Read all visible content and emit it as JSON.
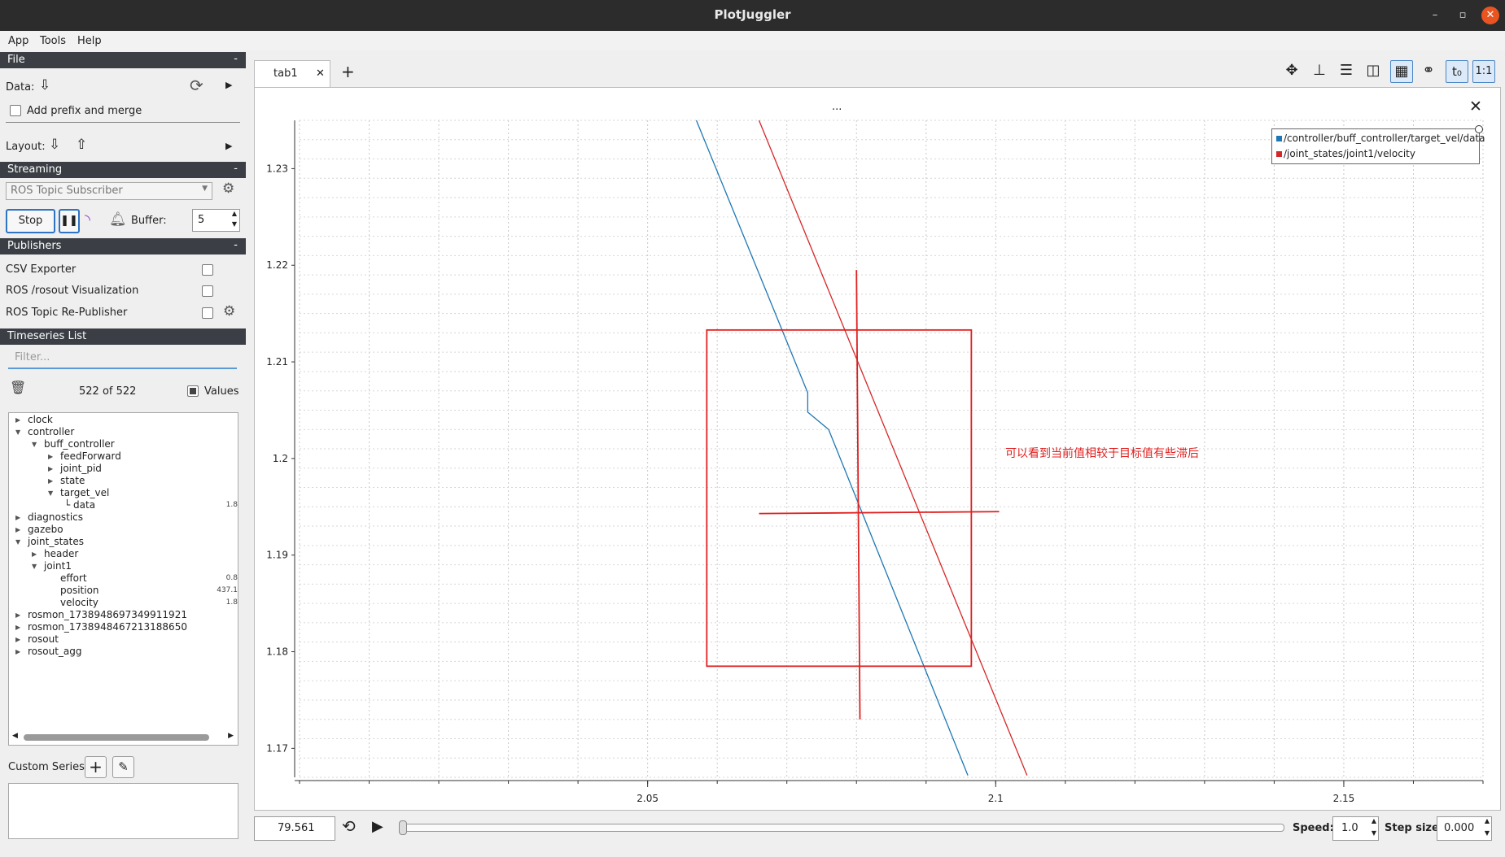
{
  "window": {
    "title": "PlotJuggler"
  },
  "menu": [
    "App",
    "Tools",
    "Help"
  ],
  "file": {
    "header": "File",
    "data_label": "Data:",
    "prefix_label": "Add prefix and merge",
    "layout_label": "Layout:"
  },
  "streaming": {
    "header": "Streaming",
    "source": "ROS Topic Subscriber",
    "stop_label": "Stop",
    "buffer_label": "Buffer:",
    "buffer_value": "5"
  },
  "publishers": {
    "header": "Publishers",
    "items": [
      "CSV Exporter",
      "ROS /rosout Visualization",
      "ROS Topic Re-Publisher"
    ]
  },
  "timeseries": {
    "header": "Timeseries List",
    "filter_placeholder": "Filter...",
    "count": "522 of 522",
    "values_label": "Values",
    "tree": [
      {
        "label": "clock",
        "arrow": "▶"
      },
      {
        "label": "controller",
        "arrow": "▼"
      },
      {
        "label": "buff_controller",
        "arrow": "▼"
      },
      {
        "label": "feedForward",
        "arrow": "▶"
      },
      {
        "label": "joint_pid",
        "arrow": "▶"
      },
      {
        "label": "state",
        "arrow": "▶"
      },
      {
        "label": "target_vel",
        "arrow": "▼"
      },
      {
        "label": "└ data",
        "value": "1.8"
      },
      {
        "label": "diagnostics",
        "arrow": "▶"
      },
      {
        "label": "gazebo",
        "arrow": "▶"
      },
      {
        "label": "joint_states",
        "arrow": "▼"
      },
      {
        "label": "header",
        "arrow": "▶"
      },
      {
        "label": "joint1",
        "arrow": "▼"
      },
      {
        "label": "effort",
        "value": "0.8"
      },
      {
        "label": "position",
        "value": "437.1"
      },
      {
        "label": "velocity",
        "value": "1.8"
      },
      {
        "label": "rosmon_1738948697349911921",
        "arrow": "▶"
      },
      {
        "label": "rosmon_1738948467213188650",
        "arrow": "▶"
      },
      {
        "label": "rosout",
        "arrow": "▶"
      },
      {
        "label": "rosout_agg",
        "arrow": "▶"
      }
    ]
  },
  "custom_series_label": "Custom Series:",
  "tabs": {
    "active": "tab1",
    "add": "+"
  },
  "plot": {
    "header_dots": "...",
    "annotation": "可以看到当前值相较于目标值有些滞后",
    "legend": [
      "/controller/buff_controller/target_vel/data",
      "/joint_states/joint1/velocity"
    ],
    "colors": {
      "series1": "#1f77b4",
      "series2": "#d62728",
      "annot": "#e02020"
    }
  },
  "chart_data": {
    "type": "line",
    "xlim": [
      2.0,
      2.17
    ],
    "ylim": [
      1.167,
      1.235
    ],
    "x_ticks": [
      2.05,
      2.1,
      2.15
    ],
    "y_ticks": [
      1.17,
      1.18,
      1.19,
      1.2,
      1.21,
      1.22,
      1.23
    ],
    "grid": true,
    "legend_placement": "top-right",
    "series": [
      {
        "name": "/controller/buff_controller/target_vel/data",
        "x": [
          2.057,
          2.073,
          2.073,
          2.076,
          2.096
        ],
        "y": [
          1.235,
          1.2068,
          1.2048,
          1.203,
          1.1672
        ]
      },
      {
        "name": "/joint_states/joint1/velocity",
        "x": [
          2.066,
          2.1045
        ],
        "y": [
          1.235,
          1.1672
        ]
      }
    ]
  },
  "playback": {
    "time": "79.561",
    "speed_label": "Speed:",
    "speed": "1.0",
    "step_label": "Step size:",
    "step": "0.000"
  }
}
